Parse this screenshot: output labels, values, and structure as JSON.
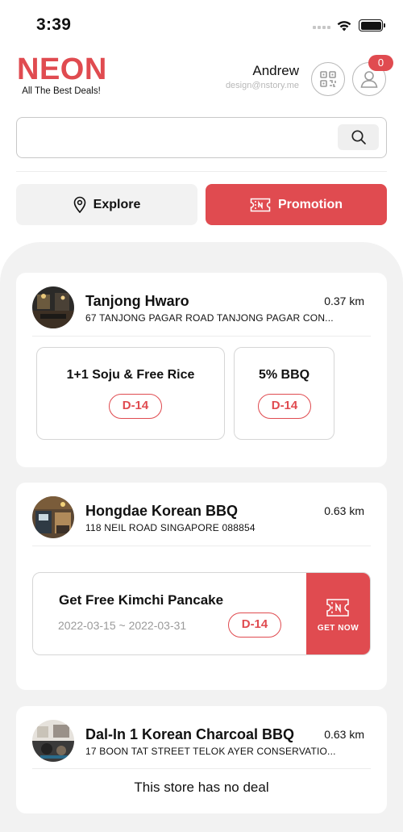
{
  "status_bar": {
    "time": "3:39"
  },
  "brand": {
    "logo": "NEON",
    "tagline": "All The Best Deals!",
    "color": "#e04b50"
  },
  "user": {
    "name": "Andrew",
    "email": "design@nstory.me",
    "notification_count": "0"
  },
  "search": {
    "placeholder": "",
    "value": ""
  },
  "tabs": [
    {
      "label": "Explore",
      "icon": "location-pin-icon",
      "active": false
    },
    {
      "label": "Promotion",
      "icon": "ticket-icon",
      "active": true
    }
  ],
  "stores": [
    {
      "name": "Tanjong Hwaro",
      "distance": "0.37 km",
      "address": "67 TANJONG PAGAR ROAD TANJONG PAGAR CON...",
      "deals": [
        {
          "title": "1+1 Soju & Free Rice",
          "dday": "D-14"
        },
        {
          "title": "5% BBQ",
          "dday": "D-14"
        }
      ]
    },
    {
      "name": "Hongdae Korean BBQ",
      "distance": "0.63 km",
      "address": "118 NEIL ROAD SINGAPORE 088854",
      "coupon": {
        "title": "Get Free Kimchi Pancake",
        "dates": "2022-03-15 ~ 2022-03-31",
        "dday": "D-14",
        "cta": "GET NOW"
      }
    },
    {
      "name": "Dal-In 1 Korean Charcoal BBQ",
      "distance": "0.63 km",
      "address": "17 BOON TAT STREET TELOK AYER CONSERVATIO...",
      "empty_message": "This store has no deal"
    }
  ]
}
